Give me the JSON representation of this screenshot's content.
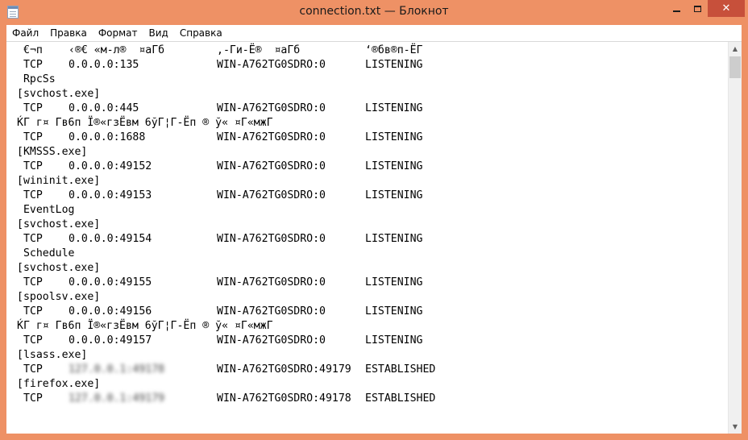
{
  "window": {
    "title": "connection.txt — Блокнот",
    "minimize_glyph": "",
    "close_glyph": "✕"
  },
  "menu": [
    "Файл",
    "Правка",
    "Формат",
    "Вид",
    "Справка"
  ],
  "icons": {
    "app": "notepad-icon",
    "minimize": "minimize-icon",
    "maximize": "maximize-icon",
    "close": "close-icon",
    "scroll_up": "chevron-up-icon",
    "scroll_down": "chevron-down-icon"
  },
  "colors": {
    "titlebar": "#EE9165",
    "close_button": "#C7503B",
    "text": "#000000"
  },
  "scroll": {
    "up_glyph": "▲",
    "down_glyph": "▼"
  },
  "lines": [
    {
      "kind": "header",
      "c1": "€¬п",
      "c2": "‹®€ «м-л®  ¤аГб",
      "c3": "‚-Ги-Ё®  ¤аГб",
      "c4": "‘®бв®п-ЁГ"
    },
    {
      "kind": "row",
      "c1": "TCP",
      "c2": "0.0.0.0:135",
      "c3": "WIN-A762TG0SDRO:0",
      "c4": "LISTENING"
    },
    {
      "kind": "text",
      "text": " RpcSs"
    },
    {
      "kind": "text",
      "text": "[svchost.exe]"
    },
    {
      "kind": "row",
      "c1": "TCP",
      "c2": "0.0.0.0:445",
      "c3": "WIN-A762TG0SDRO:0",
      "c4": "LISTENING"
    },
    {
      "kind": "text",
      "text": "ЌГ г¤ Гв6п Ї®«гзЁвм 6ўГ¦Г-Ёп ® ў« ¤Г«мжГ"
    },
    {
      "kind": "row",
      "c1": "TCP",
      "c2": "0.0.0.0:1688",
      "c3": "WIN-A762TG0SDRO:0",
      "c4": "LISTENING"
    },
    {
      "kind": "text",
      "text": "[KMSSS.exe]"
    },
    {
      "kind": "row",
      "c1": "TCP",
      "c2": "0.0.0.0:49152",
      "c3": "WIN-A762TG0SDRO:0",
      "c4": "LISTENING"
    },
    {
      "kind": "text",
      "text": "[wininit.exe]"
    },
    {
      "kind": "row",
      "c1": "TCP",
      "c2": "0.0.0.0:49153",
      "c3": "WIN-A762TG0SDRO:0",
      "c4": "LISTENING"
    },
    {
      "kind": "text",
      "text": " EventLog"
    },
    {
      "kind": "text",
      "text": "[svchost.exe]"
    },
    {
      "kind": "row",
      "c1": "TCP",
      "c2": "0.0.0.0:49154",
      "c3": "WIN-A762TG0SDRO:0",
      "c4": "LISTENING"
    },
    {
      "kind": "text",
      "text": " Schedule"
    },
    {
      "kind": "text",
      "text": "[svchost.exe]"
    },
    {
      "kind": "row",
      "c1": "TCP",
      "c2": "0.0.0.0:49155",
      "c3": "WIN-A762TG0SDRO:0",
      "c4": "LISTENING"
    },
    {
      "kind": "text",
      "text": "[spoolsv.exe]"
    },
    {
      "kind": "row",
      "c1": "TCP",
      "c2": "0.0.0.0:49156",
      "c3": "WIN-A762TG0SDRO:0",
      "c4": "LISTENING"
    },
    {
      "kind": "text",
      "text": "ЌГ г¤ Гв6п Ї®«гзЁвм 6ўГ¦Г-Ёп ® ў« ¤Г«мжГ"
    },
    {
      "kind": "row",
      "c1": "TCP",
      "c2": "0.0.0.0:49157",
      "c3": "WIN-A762TG0SDRO:0",
      "c4": "LISTENING"
    },
    {
      "kind": "text",
      "text": "[lsass.exe]"
    },
    {
      "kind": "row",
      "c1": "TCP",
      "c2": "127.0.0.1:49178",
      "c2_blur": true,
      "c3": "WIN-A762TG0SDRO:49179",
      "c4": "ESTABLISHED"
    },
    {
      "kind": "text",
      "text": "[firefox.exe]"
    },
    {
      "kind": "row",
      "c1": "TCP",
      "c2": "127.0.0.1:49179",
      "c2_blur": true,
      "c3": "WIN-A762TG0SDRO:49178",
      "c4": "ESTABLISHED"
    }
  ]
}
